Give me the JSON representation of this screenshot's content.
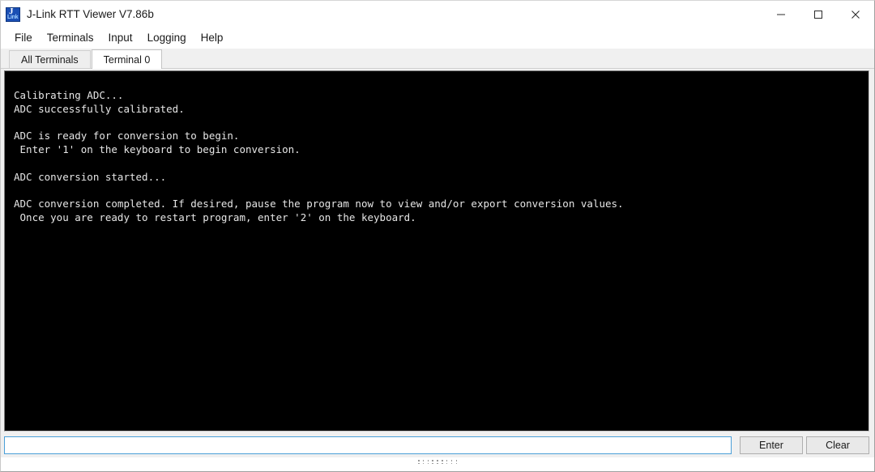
{
  "window": {
    "title": "J-Link RTT Viewer V7.86b",
    "icon_name": "jlink-app-icon",
    "icon_glyph_primary": "J",
    "icon_glyph_secondary": "Link",
    "controls": {
      "minimize_label": "Minimize",
      "maximize_label": "Maximize",
      "close_label": "Close"
    }
  },
  "menu": {
    "items": [
      {
        "label": "File"
      },
      {
        "label": "Terminals"
      },
      {
        "label": "Input"
      },
      {
        "label": "Logging"
      },
      {
        "label": "Help"
      }
    ]
  },
  "tabs": [
    {
      "label": "All Terminals",
      "active": false
    },
    {
      "label": "Terminal 0",
      "active": true
    }
  ],
  "terminal": {
    "background_color": "#000000",
    "text_color": "#e6e6e6",
    "lines": [
      "Calibrating ADC...",
      "ADC successfully calibrated.",
      "",
      "ADC is ready for conversion to begin.",
      " Enter '1' on the keyboard to begin conversion.",
      "",
      "ADC conversion started...",
      "",
      "ADC conversion completed. If desired, pause the program now to view and/or export conversion values.",
      " Once you are ready to restart program, enter '2' on the keyboard."
    ],
    "text": "Calibrating ADC...\nADC successfully calibrated.\n\nADC is ready for conversion to begin.\n Enter '1' on the keyboard to begin conversion.\n\nADC conversion started...\n\nADC conversion completed. If desired, pause the program now to view and/or export conversion values.\n Once you are ready to restart program, enter '2' on the keyboard."
  },
  "input_bar": {
    "value": "",
    "placeholder": "",
    "enter_label": "Enter",
    "clear_label": "Clear",
    "focus_color": "#4a9fd8"
  },
  "status": {
    "grip_name": "resize-grip"
  }
}
